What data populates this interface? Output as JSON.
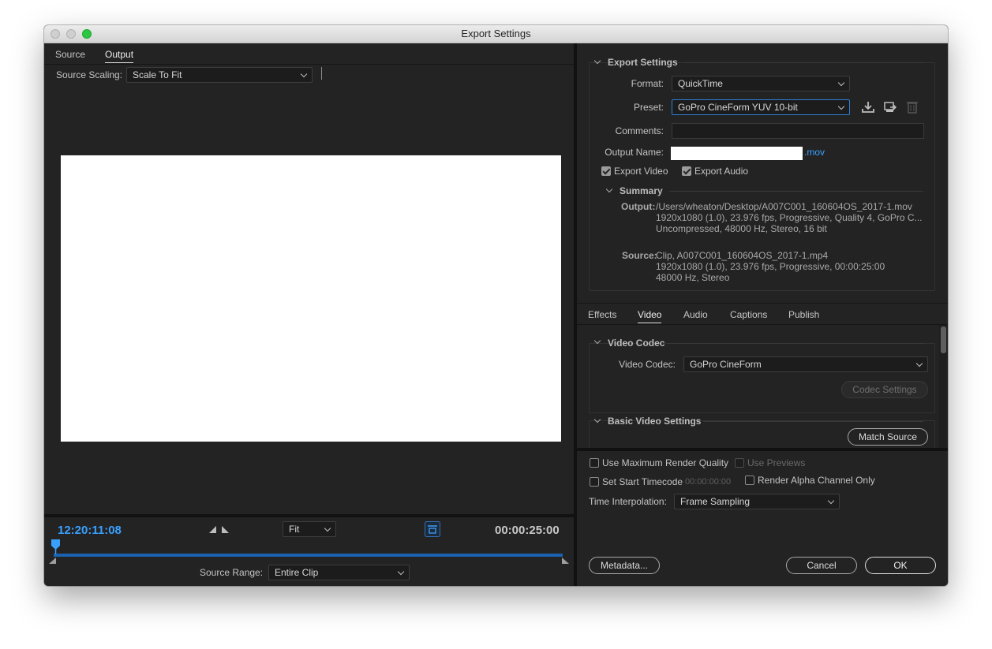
{
  "window": {
    "title": "Export Settings"
  },
  "left": {
    "tabs": [
      {
        "label": "Source"
      },
      {
        "label": "Output"
      }
    ],
    "source_scaling": {
      "label": "Source Scaling:",
      "value": "Scale To Fit"
    },
    "timeline": {
      "current_time": "12:20:11:08",
      "zoom": "Fit",
      "duration": "00:00:25:00",
      "source_range": {
        "label": "Source Range:",
        "value": "Entire Clip"
      },
      "playhead_fraction": 0.0
    }
  },
  "export_settings": {
    "heading": "Export Settings",
    "format": {
      "label": "Format:",
      "value": "QuickTime"
    },
    "preset": {
      "label": "Preset:",
      "value": "GoPro CineForm YUV 10-bit"
    },
    "comments": {
      "label": "Comments:",
      "value": ""
    },
    "output_name": {
      "label": "Output Name:",
      "value": "",
      "extension": ".mov"
    },
    "export_video": {
      "label": "Export Video",
      "checked": true
    },
    "export_audio": {
      "label": "Export Audio",
      "checked": true
    },
    "summary": {
      "heading": "Summary",
      "output_label": "Output:",
      "output_lines": [
        "/Users/wheaton/Desktop/A007C001_160604OS_2017-1.mov",
        "1920x1080 (1.0), 23.976 fps, Progressive, Quality 4, GoPro C...",
        "Uncompressed, 48000 Hz, Stereo, 16 bit"
      ],
      "source_label": "Source:",
      "source_lines": [
        "Clip, A007C001_160604OS_2017-1.mp4",
        "1920x1080 (1.0), 23.976 fps, Progressive, 00:00:25:00",
        "48000 Hz, Stereo"
      ]
    }
  },
  "settings_tabs": [
    {
      "label": "Effects"
    },
    {
      "label": "Video"
    },
    {
      "label": "Audio"
    },
    {
      "label": "Captions"
    },
    {
      "label": "Publish"
    }
  ],
  "video_codec": {
    "heading": "Video Codec",
    "label": "Video Codec:",
    "value": "GoPro CineForm",
    "codec_settings_label": "Codec Settings"
  },
  "basic_video": {
    "heading": "Basic Video Settings",
    "match_source_label": "Match Source"
  },
  "options": {
    "max_render_quality": {
      "label": "Use Maximum Render Quality",
      "checked": false
    },
    "use_previews": {
      "label": "Use Previews",
      "checked": false
    },
    "set_start_timecode": {
      "label": "Set Start Timecode",
      "checked": false,
      "value": "00:00:00:00"
    },
    "render_alpha": {
      "label": "Render Alpha Channel Only",
      "checked": false
    },
    "time_interpolation": {
      "label": "Time Interpolation:",
      "value": "Frame Sampling"
    }
  },
  "footer": {
    "metadata_label": "Metadata...",
    "cancel_label": "Cancel",
    "ok_label": "OK"
  },
  "colors": {
    "accent": "#3aa0ff",
    "panel": "#232323",
    "field": "#1c1c1c"
  }
}
